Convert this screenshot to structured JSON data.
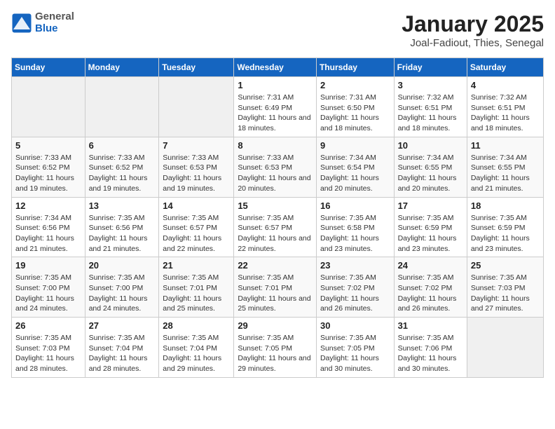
{
  "header": {
    "logo_general": "General",
    "logo_blue": "Blue",
    "month_title": "January 2025",
    "location": "Joal-Fadiout, Thies, Senegal"
  },
  "days_of_week": [
    "Sunday",
    "Monday",
    "Tuesday",
    "Wednesday",
    "Thursday",
    "Friday",
    "Saturday"
  ],
  "weeks": [
    [
      {
        "day": "",
        "info": ""
      },
      {
        "day": "",
        "info": ""
      },
      {
        "day": "",
        "info": ""
      },
      {
        "day": "1",
        "info": "Sunrise: 7:31 AM\nSunset: 6:49 PM\nDaylight: 11 hours and 18 minutes."
      },
      {
        "day": "2",
        "info": "Sunrise: 7:31 AM\nSunset: 6:50 PM\nDaylight: 11 hours and 18 minutes."
      },
      {
        "day": "3",
        "info": "Sunrise: 7:32 AM\nSunset: 6:51 PM\nDaylight: 11 hours and 18 minutes."
      },
      {
        "day": "4",
        "info": "Sunrise: 7:32 AM\nSunset: 6:51 PM\nDaylight: 11 hours and 18 minutes."
      }
    ],
    [
      {
        "day": "5",
        "info": "Sunrise: 7:33 AM\nSunset: 6:52 PM\nDaylight: 11 hours and 19 minutes."
      },
      {
        "day": "6",
        "info": "Sunrise: 7:33 AM\nSunset: 6:52 PM\nDaylight: 11 hours and 19 minutes."
      },
      {
        "day": "7",
        "info": "Sunrise: 7:33 AM\nSunset: 6:53 PM\nDaylight: 11 hours and 19 minutes."
      },
      {
        "day": "8",
        "info": "Sunrise: 7:33 AM\nSunset: 6:53 PM\nDaylight: 11 hours and 20 minutes."
      },
      {
        "day": "9",
        "info": "Sunrise: 7:34 AM\nSunset: 6:54 PM\nDaylight: 11 hours and 20 minutes."
      },
      {
        "day": "10",
        "info": "Sunrise: 7:34 AM\nSunset: 6:55 PM\nDaylight: 11 hours and 20 minutes."
      },
      {
        "day": "11",
        "info": "Sunrise: 7:34 AM\nSunset: 6:55 PM\nDaylight: 11 hours and 21 minutes."
      }
    ],
    [
      {
        "day": "12",
        "info": "Sunrise: 7:34 AM\nSunset: 6:56 PM\nDaylight: 11 hours and 21 minutes."
      },
      {
        "day": "13",
        "info": "Sunrise: 7:35 AM\nSunset: 6:56 PM\nDaylight: 11 hours and 21 minutes."
      },
      {
        "day": "14",
        "info": "Sunrise: 7:35 AM\nSunset: 6:57 PM\nDaylight: 11 hours and 22 minutes."
      },
      {
        "day": "15",
        "info": "Sunrise: 7:35 AM\nSunset: 6:57 PM\nDaylight: 11 hours and 22 minutes."
      },
      {
        "day": "16",
        "info": "Sunrise: 7:35 AM\nSunset: 6:58 PM\nDaylight: 11 hours and 23 minutes."
      },
      {
        "day": "17",
        "info": "Sunrise: 7:35 AM\nSunset: 6:59 PM\nDaylight: 11 hours and 23 minutes."
      },
      {
        "day": "18",
        "info": "Sunrise: 7:35 AM\nSunset: 6:59 PM\nDaylight: 11 hours and 23 minutes."
      }
    ],
    [
      {
        "day": "19",
        "info": "Sunrise: 7:35 AM\nSunset: 7:00 PM\nDaylight: 11 hours and 24 minutes."
      },
      {
        "day": "20",
        "info": "Sunrise: 7:35 AM\nSunset: 7:00 PM\nDaylight: 11 hours and 24 minutes."
      },
      {
        "day": "21",
        "info": "Sunrise: 7:35 AM\nSunset: 7:01 PM\nDaylight: 11 hours and 25 minutes."
      },
      {
        "day": "22",
        "info": "Sunrise: 7:35 AM\nSunset: 7:01 PM\nDaylight: 11 hours and 25 minutes."
      },
      {
        "day": "23",
        "info": "Sunrise: 7:35 AM\nSunset: 7:02 PM\nDaylight: 11 hours and 26 minutes."
      },
      {
        "day": "24",
        "info": "Sunrise: 7:35 AM\nSunset: 7:02 PM\nDaylight: 11 hours and 26 minutes."
      },
      {
        "day": "25",
        "info": "Sunrise: 7:35 AM\nSunset: 7:03 PM\nDaylight: 11 hours and 27 minutes."
      }
    ],
    [
      {
        "day": "26",
        "info": "Sunrise: 7:35 AM\nSunset: 7:03 PM\nDaylight: 11 hours and 28 minutes."
      },
      {
        "day": "27",
        "info": "Sunrise: 7:35 AM\nSunset: 7:04 PM\nDaylight: 11 hours and 28 minutes."
      },
      {
        "day": "28",
        "info": "Sunrise: 7:35 AM\nSunset: 7:04 PM\nDaylight: 11 hours and 29 minutes."
      },
      {
        "day": "29",
        "info": "Sunrise: 7:35 AM\nSunset: 7:05 PM\nDaylight: 11 hours and 29 minutes."
      },
      {
        "day": "30",
        "info": "Sunrise: 7:35 AM\nSunset: 7:05 PM\nDaylight: 11 hours and 30 minutes."
      },
      {
        "day": "31",
        "info": "Sunrise: 7:35 AM\nSunset: 7:06 PM\nDaylight: 11 hours and 30 minutes."
      },
      {
        "day": "",
        "info": ""
      }
    ]
  ]
}
